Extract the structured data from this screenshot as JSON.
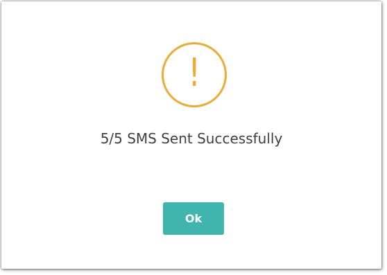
{
  "dialog": {
    "icon": "exclamation-icon",
    "icon_glyph": "!",
    "icon_color": "#eeab32",
    "message": "5/5 SMS Sent Successfully",
    "ok_label": "Ok",
    "button_color": "#40b5ad"
  }
}
